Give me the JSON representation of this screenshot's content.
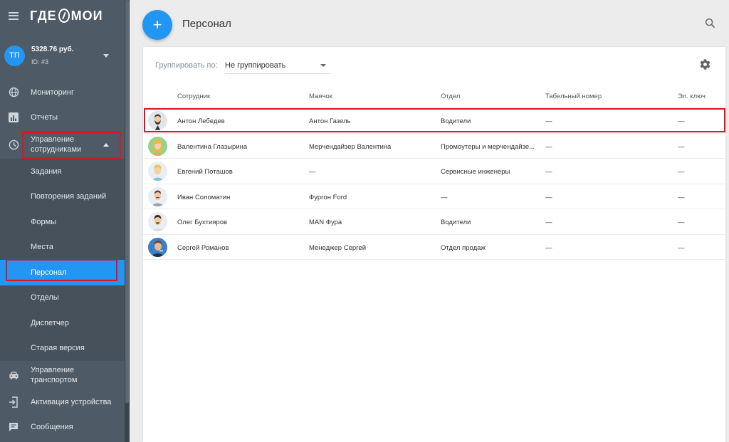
{
  "app": {
    "logo_text_left": "ГДЕ",
    "logo_text_right": "МОИ"
  },
  "account": {
    "initials": "ТП",
    "balance": "5328.76 руб.",
    "id": "ID: #3"
  },
  "sidebar": {
    "items": [
      {
        "label": "Мониторинг",
        "icon": "globe-icon"
      },
      {
        "label": "Отчеты",
        "icon": "bar-chart-icon"
      },
      {
        "label": "Управление сотрудниками",
        "icon": "clock-icon"
      },
      {
        "label": "Управление транспортом",
        "icon": "car-icon"
      },
      {
        "label": "Активация устройства",
        "icon": "device-login-icon"
      },
      {
        "label": "Сообщения",
        "icon": "message-icon"
      }
    ],
    "submenu": [
      {
        "label": "Задания"
      },
      {
        "label": "Повторения заданий"
      },
      {
        "label": "Формы"
      },
      {
        "label": "Места"
      },
      {
        "label": "Персонал"
      },
      {
        "label": "Отделы"
      },
      {
        "label": "Диспетчер"
      },
      {
        "label": "Старая версия"
      }
    ]
  },
  "header": {
    "title": "Персонал",
    "add_label": "+"
  },
  "toolbar": {
    "group_label": "Группировать по:",
    "group_value": "Не группировать"
  },
  "table": {
    "columns": [
      "Сотрудник",
      "Маячок",
      "Отдел",
      "Табельный номер",
      "Эл. ключ"
    ],
    "rows": [
      {
        "name": "Антон Лебедев",
        "beacon": "Антон Газель",
        "department": "Водители",
        "number": "—",
        "key": "—",
        "avatar": "man-beard"
      },
      {
        "name": "Валентина Глазырина",
        "beacon": "Мерчендайзер Валентина",
        "department": "Промоутеры и мерчендайзе...",
        "number": "—",
        "key": "—",
        "avatar": "woman"
      },
      {
        "name": "Евгений Поташов",
        "beacon": "—",
        "department": "Сервисные инженеры",
        "number": "—",
        "key": "—",
        "avatar": "man-blond"
      },
      {
        "name": "Иван Соломатин",
        "beacon": "Фургон Ford",
        "department": "—",
        "number": "—",
        "key": "—",
        "avatar": "man-mustache"
      },
      {
        "name": "Олег Бухтияров",
        "beacon": "MAN Фура",
        "department": "Водители",
        "number": "—",
        "key": "—",
        "avatar": "man-dark"
      },
      {
        "name": "Сергей Романов",
        "beacon": "Менеджер Сергей",
        "department": "Отдел продаж",
        "number": "—",
        "key": "—",
        "avatar": "man-photo"
      }
    ]
  },
  "colors": {
    "accent": "#2196f3",
    "sidebar_bg": "#4e5a65",
    "highlight_red": "#e0141e"
  }
}
